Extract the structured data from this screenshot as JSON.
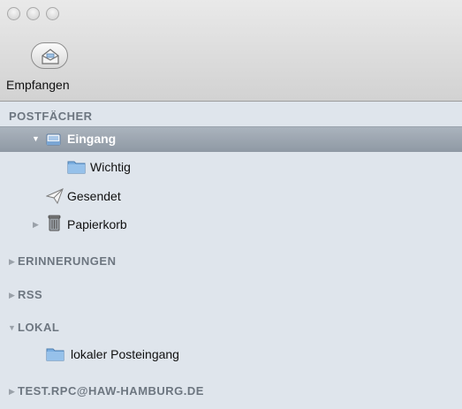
{
  "toolbar": {
    "receive_label": "Empfangen"
  },
  "sidebar": {
    "sections": {
      "postfaecher": "POSTFÄCHER",
      "erinnerungen": "ERINNERUNGEN",
      "rss": "RSS",
      "lokal": "LOKAL",
      "account": "TEST.RPC@HAW-HAMBURG.DE"
    },
    "mailboxes": {
      "inbox": "Eingang",
      "important": "Wichtig",
      "sent": "Gesendet",
      "trash": "Papierkorb",
      "local_inbox": "lokaler Posteingang"
    }
  },
  "icons": {
    "inbox": "inbox-tray-icon",
    "folder": "folder-icon",
    "sent": "paper-plane-icon",
    "trash": "trash-can-icon"
  },
  "colors": {
    "selection": "#98a2ad",
    "folder_blue": "#7aaee0",
    "section_text": "#6d7680"
  }
}
